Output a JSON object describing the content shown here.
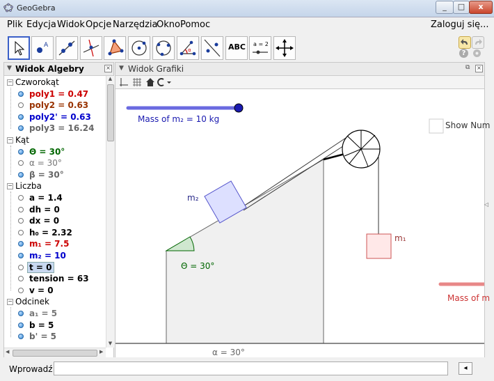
{
  "window": {
    "title": "GeoGebra",
    "min": "_",
    "max": "□",
    "close": "x"
  },
  "menu": {
    "items": [
      "Plik",
      "Edycja",
      "Widok",
      "Opcje",
      "Narzędzia",
      "Okno",
      "Pomoc"
    ],
    "login": "Zaloguj się..."
  },
  "toolbar": {
    "tools": [
      "move-tool",
      "point-tool",
      "line-tool",
      "perpendicular-tool",
      "polygon-tool",
      "circle-tool",
      "conic-tool",
      "angle-tool",
      "reflect-tool",
      "text-tool",
      "slider-tool",
      "move-view-tool"
    ],
    "text_label": "ABC",
    "slider_label": "a = 2"
  },
  "algebra": {
    "title": "Widok Algebry",
    "groups": [
      {
        "name": "Czworokąt",
        "items": [
          {
            "text": "poly1 = 0.47",
            "color": "#cc0000",
            "dot": "on"
          },
          {
            "text": "poly2 = 0.63",
            "color": "#993300",
            "dot": "off"
          },
          {
            "text": "poly2' = 0.63",
            "color": "#0000cc",
            "dot": "on"
          },
          {
            "text": "poly3 = 16.24",
            "color": "#666666",
            "dot": "on"
          }
        ]
      },
      {
        "name": "Kąt",
        "items": [
          {
            "text": "Θ = 30°",
            "color": "#006600",
            "dot": "on"
          },
          {
            "text": "α = 30°",
            "color": "#777777",
            "dot": "off",
            "normal": true
          },
          {
            "text": "β = 30°",
            "color": "#666666",
            "dot": "on"
          }
        ]
      },
      {
        "name": "Liczba",
        "items": [
          {
            "text": "a = 1.4",
            "color": "#000000",
            "dot": "off"
          },
          {
            "text": "dh = 0",
            "color": "#000000",
            "dot": "off"
          },
          {
            "text": "dx = 0",
            "color": "#000000",
            "dot": "off"
          },
          {
            "text": "h₀ = 2.32",
            "color": "#000000",
            "dot": "off"
          },
          {
            "text": "m₁ = 7.5",
            "color": "#cc0000",
            "dot": "on"
          },
          {
            "text": "m₂ = 10",
            "color": "#0000cc",
            "dot": "on"
          },
          {
            "text": "t = 0",
            "color": "#000000",
            "dot": "off",
            "selected": true
          },
          {
            "text": "tension = 63",
            "color": "#000000",
            "dot": "off"
          },
          {
            "text": "v = 0",
            "color": "#000000",
            "dot": "off"
          }
        ]
      },
      {
        "name": "Odcinek",
        "items": [
          {
            "text": "a₁ = 5",
            "color": "#777777",
            "dot": "on"
          },
          {
            "text": "b = 5",
            "color": "#000000",
            "dot": "on"
          },
          {
            "text": "b' = 5",
            "color": "#666666",
            "dot": "on"
          }
        ]
      }
    ]
  },
  "graphics": {
    "title": "Widok Grafiki",
    "slider_label": "Mass of m₂ = 10 kg",
    "checkbox_label": "Show Num",
    "m1_label": "m₁",
    "m2_label": "m₂",
    "theta_label": "Θ = 30°",
    "alpha_label": "α = 30°",
    "slider2_label": "Mass of m",
    "colors": {
      "slider": "#6a6ae0",
      "slider_knob": "#1a1ab0",
      "m2_fill": "#dde0ff",
      "m2_stroke": "#5555cc",
      "m1_fill": "#ffe8e8",
      "m1_stroke": "#cc5555",
      "angle": "#006600",
      "slider2": "#e88888"
    }
  },
  "inputbar": {
    "label": "Wprowadź:",
    "value": ""
  }
}
